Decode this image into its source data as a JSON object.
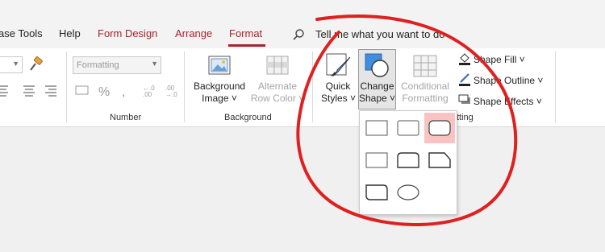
{
  "tabs": {
    "database_tools": "ase Tools",
    "help": "Help",
    "form_design": "Form Design",
    "arrange": "Arrange",
    "format": "Format"
  },
  "tellme": {
    "text": "Tell me what you want to do"
  },
  "number_group": {
    "label": "Number",
    "format_combo": "Formatting"
  },
  "background_group": {
    "label": "Background",
    "background_image": {
      "line1": "Background",
      "line2": "Image ˅"
    },
    "alternate_row_color": {
      "line1": "Alternate",
      "line2": "Row Color ˅"
    }
  },
  "control_formatting_group": {
    "label": "tting",
    "quick_styles": {
      "line1": "Quick",
      "line2": "Styles ˅"
    },
    "change_shape": {
      "line1": "Change",
      "line2": "Shape ˅"
    },
    "conditional_formatting": {
      "line1": "Conditional",
      "line2": "Formatting"
    },
    "shape_fill": "Shape Fill ˅",
    "shape_outline": "Shape Outline ˅",
    "shape_effects": "Shape Effects ˅"
  },
  "shape_gallery": {
    "items": [
      "Rectangle",
      "Rounded Rectangle",
      "Rounded Rectangle",
      "Snip Single Corner",
      "Round Same Side Corner",
      "Snip Same Side Corner",
      "Round Diagonal Corner",
      "Oval"
    ],
    "selected_index": 2
  },
  "colors": {
    "accent": "#a4262c",
    "annotation": "#e02020",
    "selected": "#f9c3c3"
  }
}
